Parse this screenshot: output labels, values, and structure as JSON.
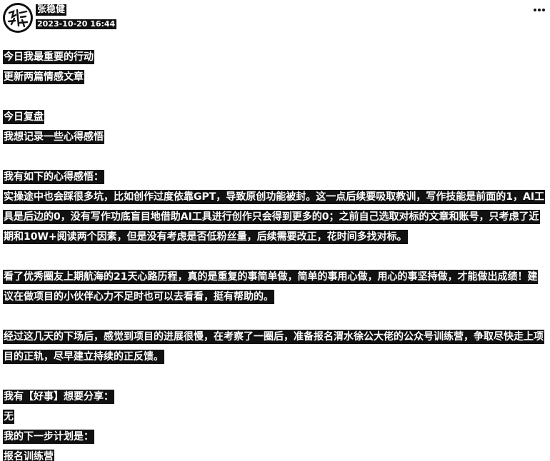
{
  "post": {
    "author": "张稳健",
    "timestamp": "2023-10-20 16:44",
    "more_icon": "more-dots-icon",
    "avatar_icon": "avatar-icon"
  },
  "content": {
    "heading_1": "今日我最重要的行动",
    "line_1": "更新两篇情感文章",
    "heading_2": "今日复盘",
    "line_2": "我想记录一些心得感悟",
    "heading_3": "我有如下的心得感悟：",
    "para_1": "实操途中也会踩很多坑，比如创作过度依靠GPT，导致原创功能被封。这一点后续要吸取教训，写作技能是前面的1，AI工具是后边的0，没有写作功底盲目地借助AI工具进行创作只会得到更多的0；之前自己选取对标的文章和账号，只考虑了近期和10W+阅读两个因素，但是没有考虑是否低粉丝量，后续需要改正，花时间多找对标。",
    "para_2": "看了优秀圈友上期航海的21天心路历程，真的是重复的事简单做，简单的事用心做，用心的事坚持做，才能做出成绩！建议在做项目的小伙伴心力不足时也可以去看看，挺有帮助的。",
    "para_3": "经过这几天的下场后，感觉到项目的进展很慢，在考察了一圈后，准备报名渭水徐公大佬的公众号训练营，争取尽快走上项目的正轨，尽早建立持续的正反馈。",
    "heading_4": "我有【好事】想要分享：",
    "line_4": "无",
    "heading_5": "我的下一步计划是：",
    "line_5": "报名训练营"
  }
}
